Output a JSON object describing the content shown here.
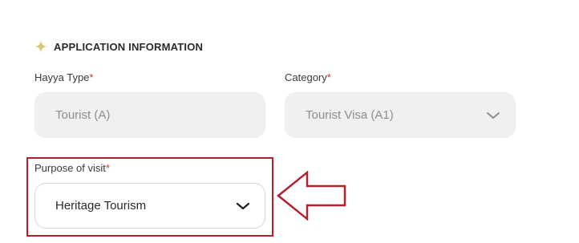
{
  "section": {
    "title": "APPLICATION INFORMATION",
    "icon": "sparkle-icon",
    "icon_color": "#d8c87a"
  },
  "fields": {
    "hayya_type": {
      "label": "Hayya Type",
      "required_mark": "*",
      "value": "Tourist (A)",
      "disabled": true
    },
    "category": {
      "label": "Category",
      "required_mark": "*",
      "value": "Tourist Visa (A1)",
      "disabled": true,
      "icon": "chevron-down-icon"
    },
    "purpose_of_visit": {
      "label": "Purpose of visit",
      "required_mark": "*",
      "value": "Heritage Tourism",
      "disabled": false,
      "icon": "chevron-down-icon"
    }
  },
  "annotation": {
    "highlight_color": "#b3222b",
    "arrow_icon": "left-arrow-icon"
  }
}
